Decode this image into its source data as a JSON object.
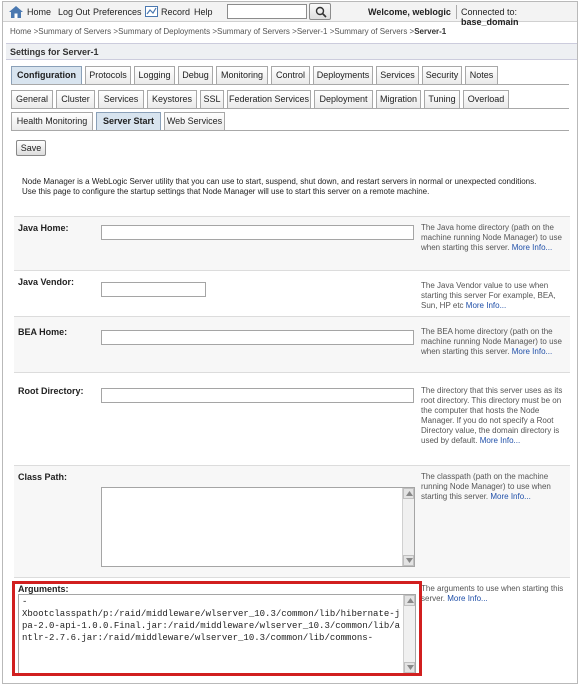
{
  "header": {
    "home": "Home",
    "logout": "Log Out",
    "preferences": "Preferences",
    "record": "Record",
    "help": "Help",
    "search_value": "",
    "welcome": "Welcome, weblogic",
    "connected_label": "Connected to:",
    "connected_domain": "base_domain"
  },
  "breadcrumb": {
    "items": [
      "Home",
      "Summary of Servers",
      "Summary of Deployments",
      "Summary of Servers",
      "Server-1",
      "Summary of Servers"
    ],
    "current": "Server-1",
    "sep": " >"
  },
  "settings_title": "Settings for Server-1",
  "tabs_main": [
    "Configuration",
    "Protocols",
    "Logging",
    "Debug",
    "Monitoring",
    "Control",
    "Deployments",
    "Services",
    "Security",
    "Notes"
  ],
  "tabs_sub1": [
    "General",
    "Cluster",
    "Services",
    "Keystores",
    "SSL",
    "Federation Services",
    "Deployment",
    "Migration",
    "Tuning",
    "Overload"
  ],
  "tabs_sub2": [
    "Health Monitoring",
    "Server Start",
    "Web Services"
  ],
  "save_label": "Save",
  "intro": "Node Manager is a WebLogic Server utility that you can use to start, suspend, shut down, and restart servers in normal or unexpected conditions. Use this page to configure the startup settings that Node Manager will use to start this server on a remote machine.",
  "fields": {
    "java_home": {
      "label": "Java Home:",
      "value": "",
      "help": "The Java home directory (path on the machine running Node Manager) to use when starting this server.",
      "more": "More Info..."
    },
    "java_vendor": {
      "label": "Java Vendor:",
      "value": "",
      "help": "The Java Vendor value to use when starting this server For example, BEA, Sun, HP etc",
      "more": "More Info..."
    },
    "bea_home": {
      "label": "BEA Home:",
      "value": "",
      "help": "The BEA home directory (path on the machine running Node Manager) to use when starting this server.",
      "more": "More Info..."
    },
    "root_directory": {
      "label": "Root Directory:",
      "value": "",
      "help": "The directory that this server uses as its root directory. This directory must be on the computer that hosts the Node Manager. If you do not specify a Root Directory value, the domain directory is used by default.",
      "more": "More Info..."
    },
    "class_path": {
      "label": "Class Path:",
      "value": "",
      "help": "The classpath (path on the machine running Node Manager) to use when starting this server.",
      "more": "More Info..."
    },
    "arguments": {
      "label": "Arguments:",
      "value": "-\nXbootclasspath/p:/raid/middleware/wlserver_10.3/common/lib/hibernate-jpa-2.0-api-1.0.0.Final.jar:/raid/middleware/wlserver_10.3/common/lib/antlr-2.7.6.jar:/raid/middleware/wlserver_10.3/common/lib/commons-",
      "help": "The arguments to use when starting this server.",
      "more": "More Info..."
    }
  },
  "colors": {
    "highlight": "#d11f1f",
    "link": "#1f4fa8",
    "active_tab": "#d8e4ef"
  }
}
